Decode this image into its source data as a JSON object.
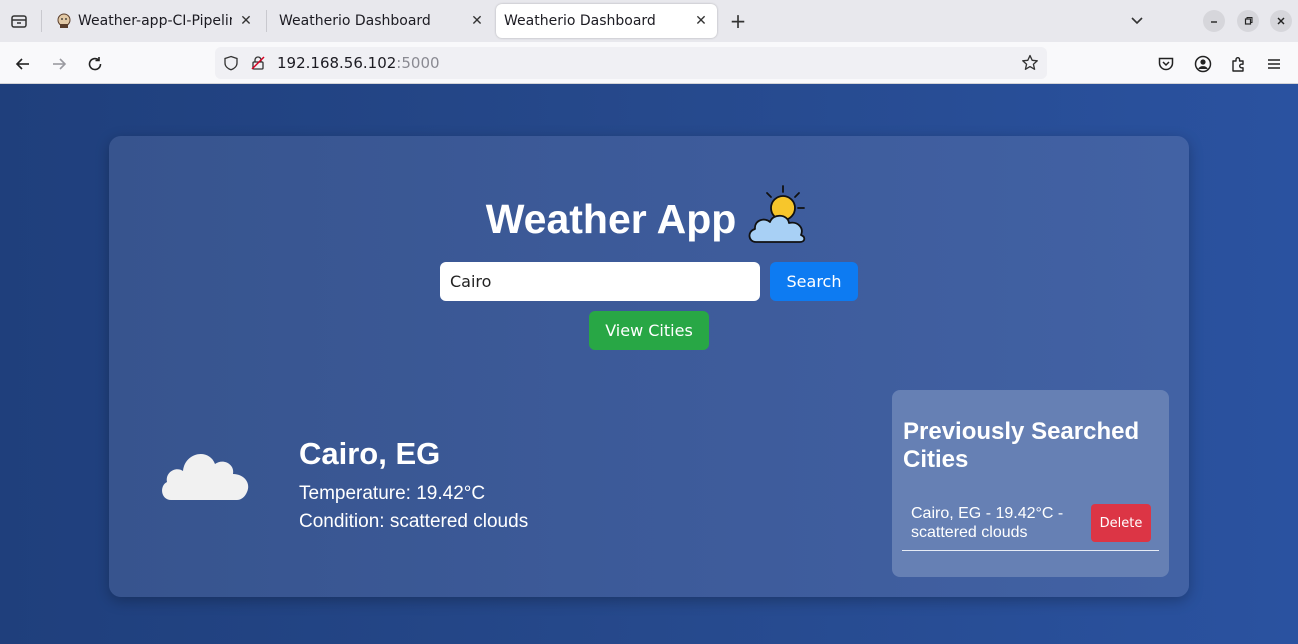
{
  "browser": {
    "tabs": [
      {
        "title": "Weather-app-CI-Pipeline [",
        "active": false
      },
      {
        "title": "Weatherio Dashboard",
        "active": false
      },
      {
        "title": "Weatherio Dashboard",
        "active": true
      }
    ],
    "new_tab_symbol": "+",
    "url_host": "192.168.56.102",
    "url_port": ":5000",
    "icons": [
      "tab-overview-icon",
      "back-arrow-icon",
      "forward-arrow-icon",
      "reload-icon",
      "shield-icon",
      "insecure-lock-icon",
      "bookmark-star-icon",
      "pocket-icon",
      "account-icon",
      "extensions-icon",
      "menu-icon",
      "chevron-down-icon",
      "minimize-icon",
      "restore-icon",
      "close-icon"
    ]
  },
  "app": {
    "title": "Weather App",
    "search_value": "Cairo",
    "search_label": "Search",
    "view_cities_label": "View Cities",
    "weather": {
      "city": "Cairo, EG",
      "temperature": "Temperature: 19.42°C",
      "condition": "Condition: scattered clouds"
    },
    "history": {
      "title": "Previously Searched Cities",
      "items": [
        {
          "text": "Cairo, EG - 19.42°C - scattered clouds",
          "delete_label": "Delete"
        }
      ]
    },
    "colors": {
      "search_button": "#0d7bf2",
      "view_button": "#28a745",
      "delete_button": "#dc3545",
      "background": "#26498c"
    }
  }
}
